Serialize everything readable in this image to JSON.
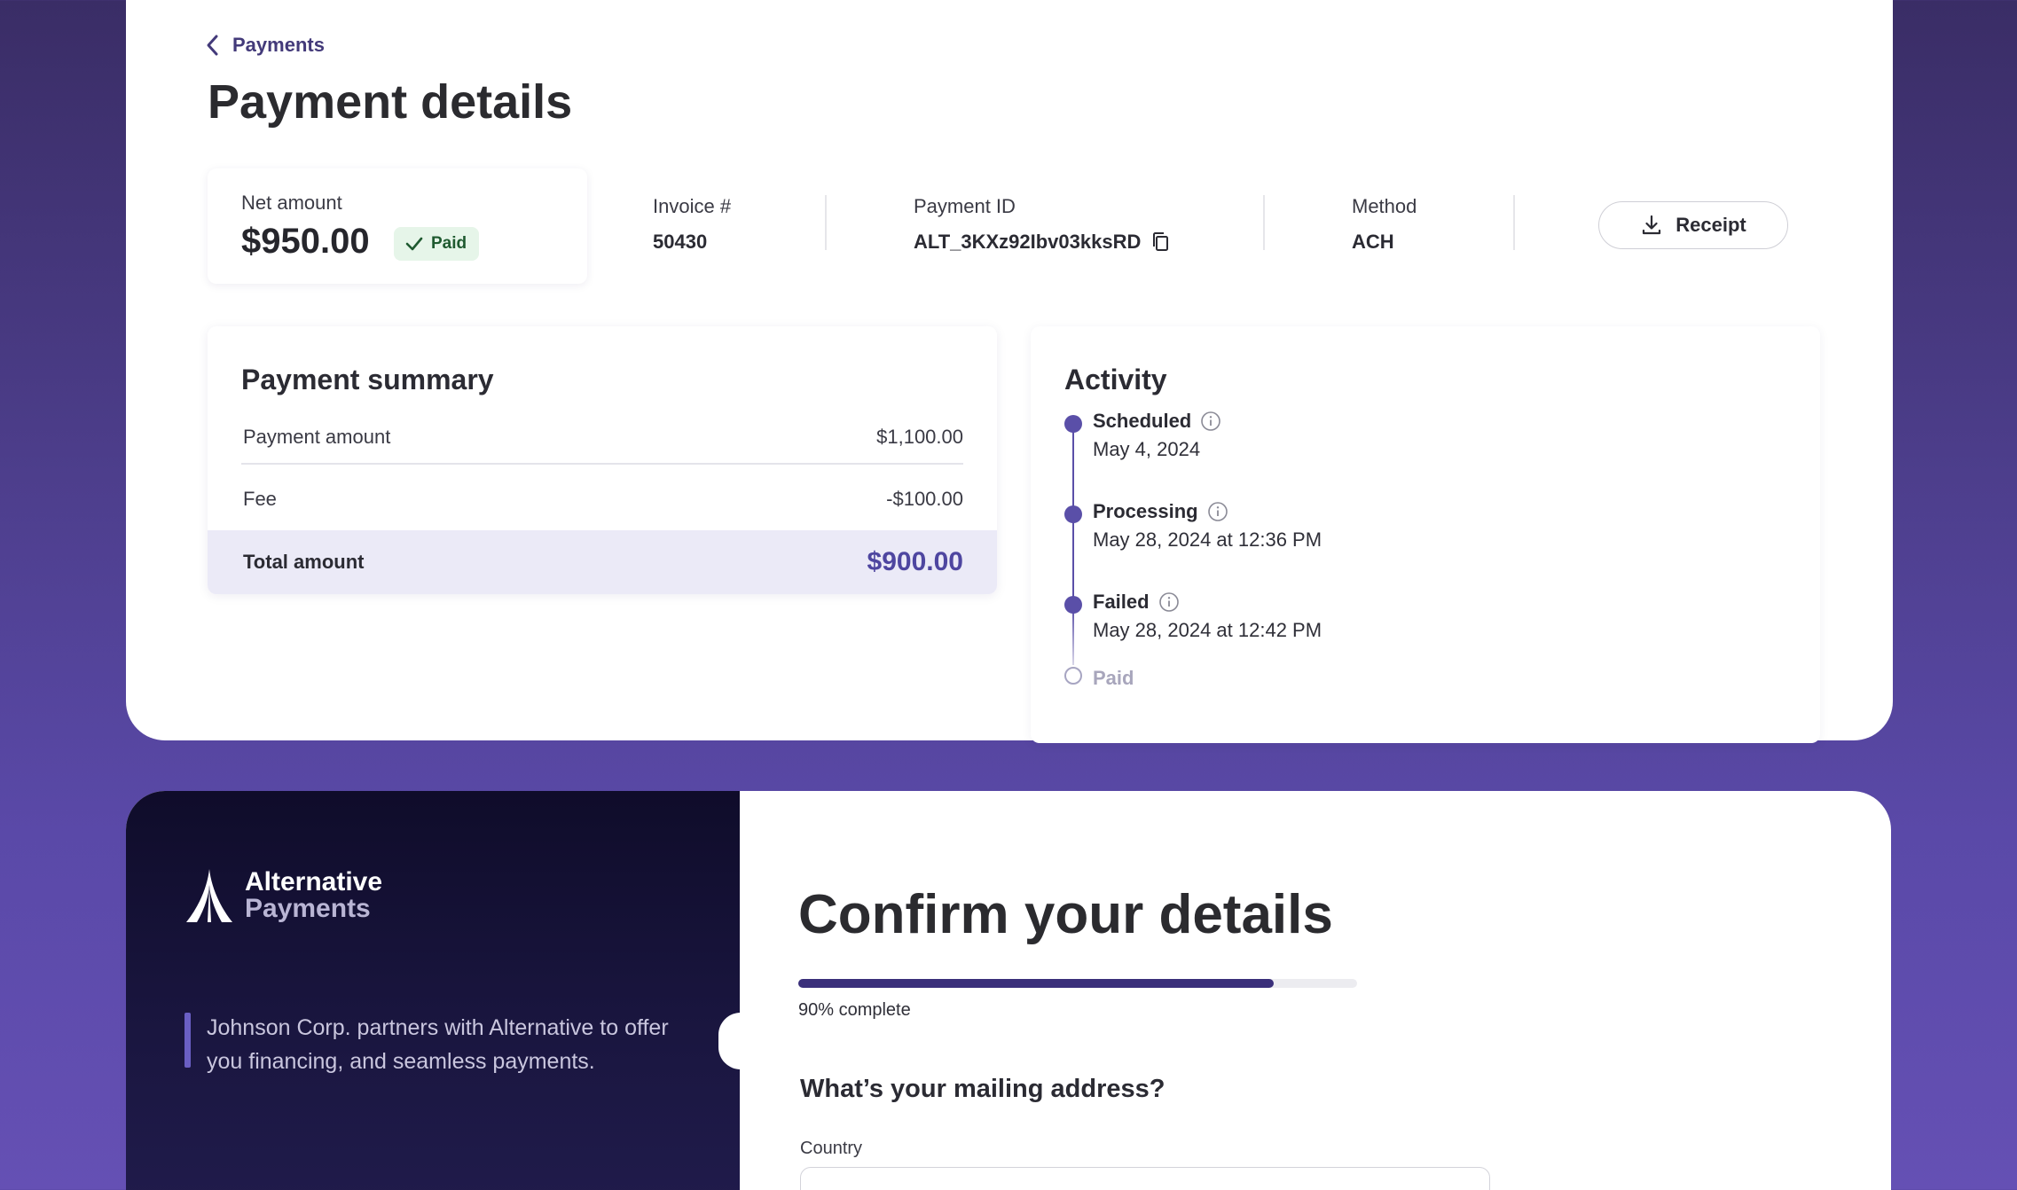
{
  "payment": {
    "back_label": "Payments",
    "title": "Payment details",
    "net_amount_label": "Net amount",
    "net_amount_value": "$950.00",
    "status_badge": "Paid",
    "invoice_label": "Invoice #",
    "invoice_value": "50430",
    "payment_id_label": "Payment ID",
    "payment_id_value": "ALT_3KXz92Ibv03kksRD",
    "method_label": "Method",
    "method_value": "ACH",
    "receipt_button": "Receipt"
  },
  "summary": {
    "title": "Payment summary",
    "rows": [
      {
        "label": "Payment amount",
        "value": "$1,100.00"
      },
      {
        "label": "Fee",
        "value": "-$100.00"
      }
    ],
    "total_label": "Total amount",
    "total_value": "$900.00"
  },
  "activity": {
    "title": "Activity",
    "events": [
      {
        "status": "Scheduled",
        "date": "May 4, 2024"
      },
      {
        "status": "Processing",
        "date": "May 28, 2024 at 12:36 PM"
      },
      {
        "status": "Failed",
        "date": "May 28, 2024 at 12:42 PM"
      },
      {
        "status": "Paid",
        "date": ""
      }
    ]
  },
  "onboarding": {
    "brand_line1": "Alternative",
    "brand_line2": "Payments",
    "partner_text": "Johnson Corp. partners with Alternative to offer you financing, and seamless payments.",
    "title": "Confirm your details",
    "progress_percent": 85,
    "progress_label": "90% complete",
    "question": "What’s your mailing address?",
    "country_label": "Country",
    "country_value": ""
  },
  "colors": {
    "accent": "#5a4fa8",
    "total_bg": "#ebeaf7",
    "paid_badge_bg": "#e6f5e9",
    "dark_panel": "#0f0c2a"
  }
}
